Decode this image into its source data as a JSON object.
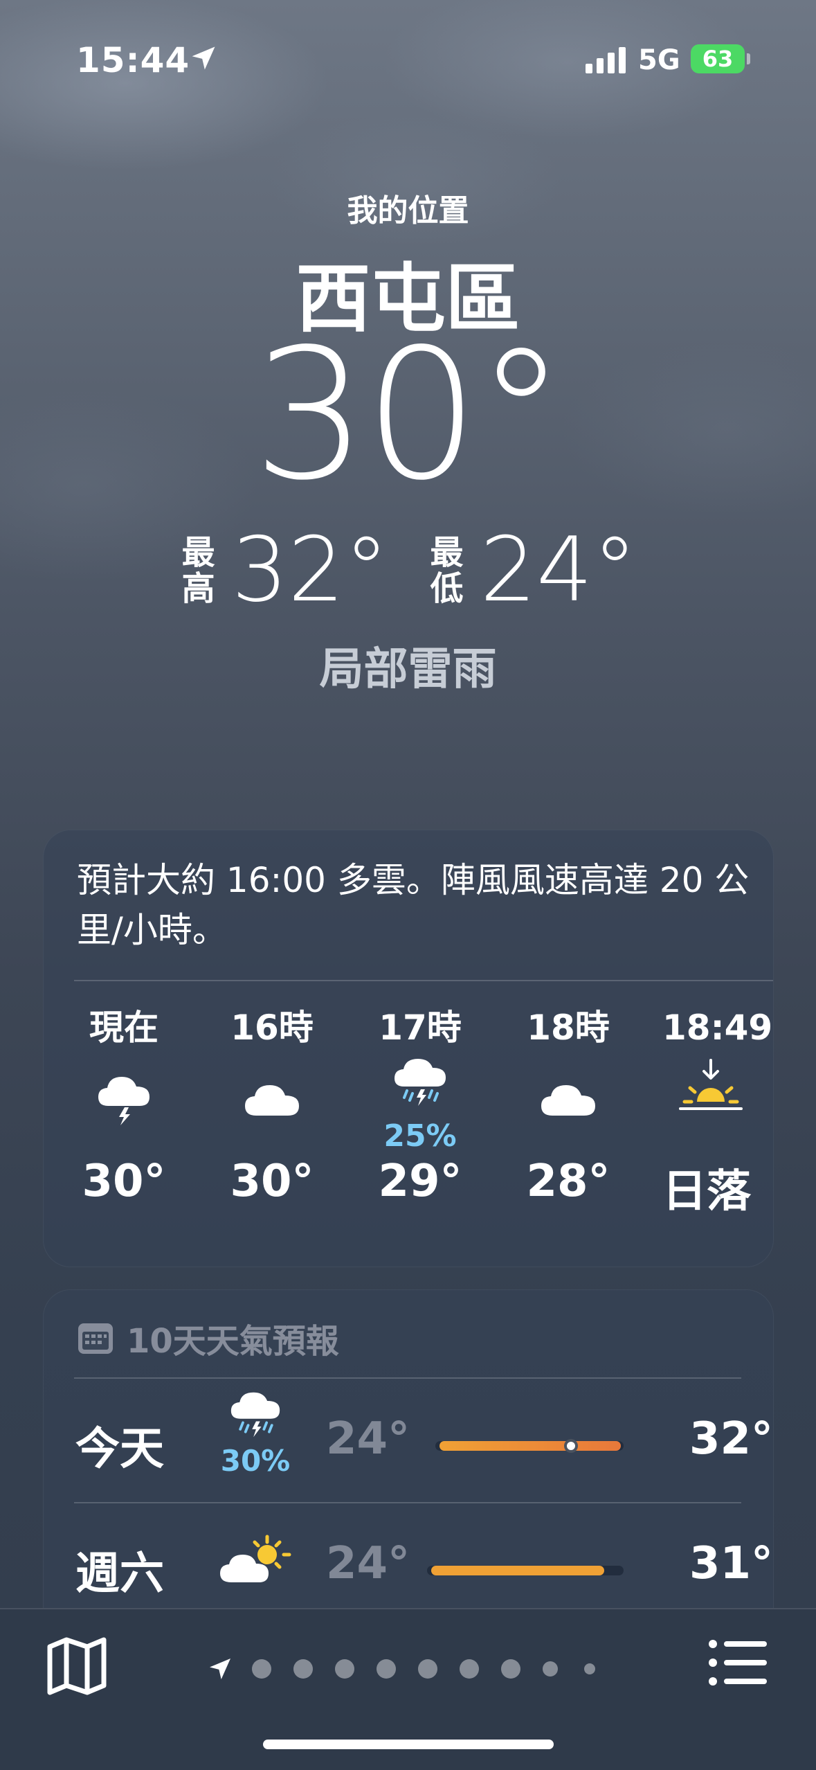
{
  "status": {
    "time": "15:44",
    "network": "5G",
    "battery": "63"
  },
  "location": {
    "label": "我的位置",
    "city": "西屯區"
  },
  "current": {
    "temp": "30°",
    "high_label": "最高",
    "high": "32°",
    "low_label": "最低",
    "low": "24°",
    "condition": "局部雷雨"
  },
  "hourly": {
    "summary": "預計大約 16:00 多雲。陣風風速高達 20 公里/小時。",
    "items": [
      {
        "label": "現在",
        "icon": "thunderstorm-icon",
        "temp": "30°",
        "precip": ""
      },
      {
        "label": "16時",
        "icon": "cloud-icon",
        "temp": "30°",
        "precip": ""
      },
      {
        "label": "17時",
        "icon": "thunder-rain-icon",
        "temp": "29°",
        "precip": "25%"
      },
      {
        "label": "18時",
        "icon": "cloud-icon",
        "temp": "28°",
        "precip": ""
      },
      {
        "label": "18:49",
        "icon": "sunset-icon",
        "temp": "日落",
        "precip": ""
      }
    ]
  },
  "daily": {
    "header": "10天天氣預報",
    "rows": [
      {
        "day": "今天",
        "icon": "thunder-rain-icon",
        "precip": "30%",
        "low": "24°",
        "high": "32°",
        "current_marker": "30°"
      },
      {
        "day": "週六",
        "icon": "partly-sunny-icon",
        "precip": "",
        "low": "24°",
        "high": "31°"
      }
    ]
  },
  "colors": {
    "accent_precip": "#7ccbf5",
    "bar_warm": "#f0a135",
    "bar_hot": "#e8783a",
    "battery": "#4cd964"
  }
}
